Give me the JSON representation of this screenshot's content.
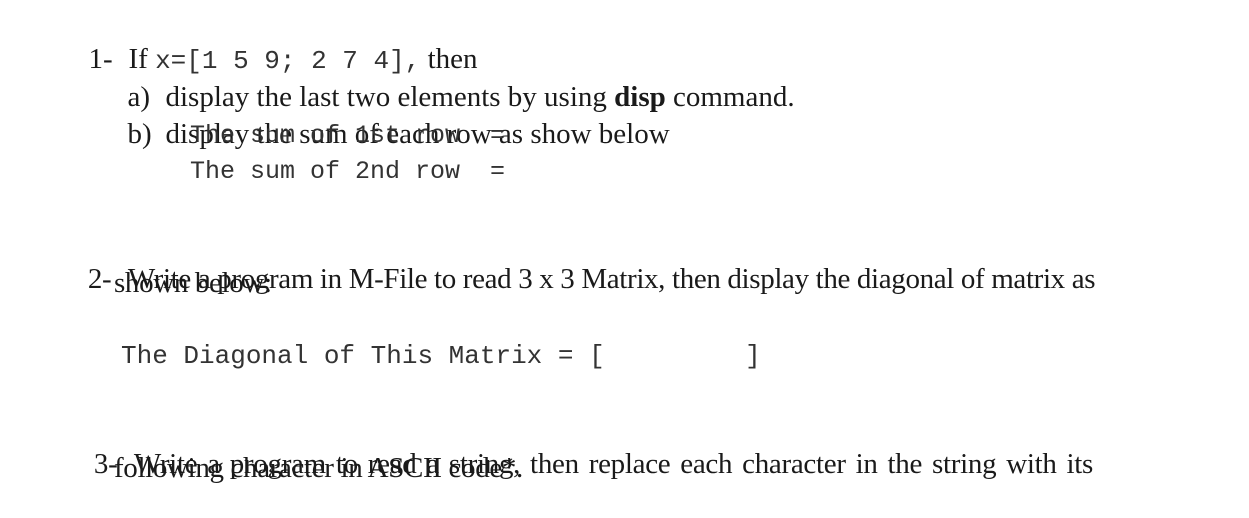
{
  "questions": [
    {
      "number": "1-",
      "intro_prefix": "If ",
      "intro_code": "x=[1 5 9; 2 7 4],",
      "intro_suffix": " then",
      "parts": [
        {
          "label": "a)",
          "text_before": "display the last two elements by using ",
          "bold": "disp",
          "text_after": " command."
        },
        {
          "label": "b)",
          "text": "display the sum of each row as show below"
        }
      ],
      "output_lines": [
        "The sum of 1st row  =",
        "The sum of 2nd row  ="
      ]
    },
    {
      "number": "2-",
      "text_line1": "Write a program in M-File to read 3 x 3 Matrix, then display the diagonal of matrix as",
      "text_line2": "shown below:",
      "output_line": "The Diagonal of This Matrix = [         ]"
    },
    {
      "number": "3-",
      "text_line1": "Write a program to read a string, then replace each character in the string with its",
      "text_line2": "following character in ASCII code*."
    }
  ]
}
